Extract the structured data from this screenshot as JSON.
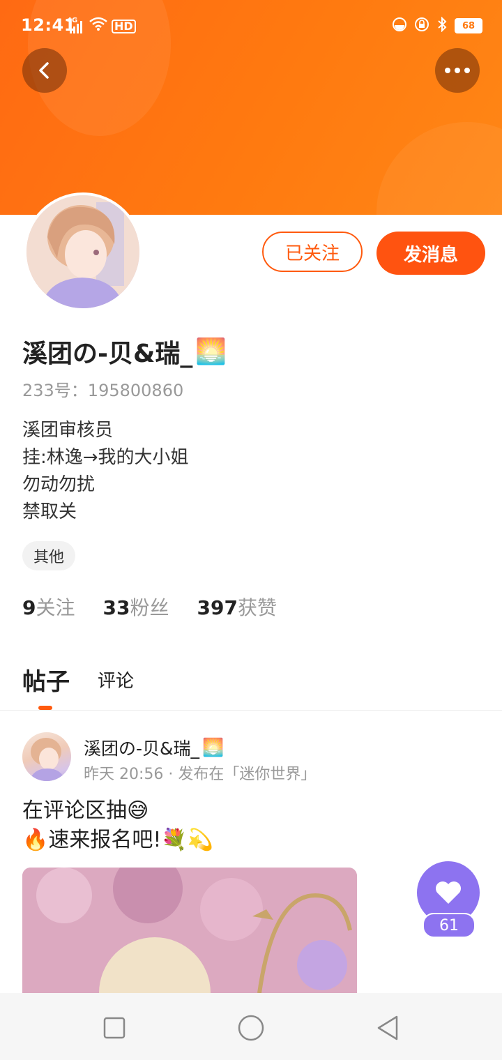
{
  "status_bar": {
    "time": "12:41",
    "network": "4G",
    "hd": "HD",
    "battery": "68",
    "icons": [
      "signal-icon",
      "wifi-icon",
      "hd-icon",
      "mute-icon",
      "lock-icon",
      "bluetooth-icon",
      "battery-icon"
    ]
  },
  "header": {
    "back_icon": "chevron-left-icon",
    "more_icon": "more-dots-icon"
  },
  "profile": {
    "followed_label": "已关注",
    "message_label": "发消息",
    "name": "溪团の-贝&瑞_",
    "name_emoji": "🌅",
    "id_text": "233号：195800860",
    "bio": [
      "溪团审核员",
      "挂:林逸→我的大小姐",
      "勿动勿扰",
      "禁取关"
    ],
    "tag": "其他",
    "stats": [
      {
        "value": "9",
        "label": "关注"
      },
      {
        "value": "33",
        "label": "粉丝"
      },
      {
        "value": "397",
        "label": "获赞"
      }
    ]
  },
  "tabs": {
    "posts": "帖子",
    "comments": "评论",
    "active": "帖子"
  },
  "post": {
    "author": "溪团の-贝&瑞_",
    "author_emoji": "🌅",
    "meta": "昨天 20:56 · 发布在「迷你世界」",
    "line1": "在评论区抽😅",
    "line2": "🔥速来报名吧!💐💫",
    "likes": "61"
  },
  "colors": {
    "accent": "#ff5a0e",
    "banner": "#ff7a10",
    "like": "#8d73f0"
  }
}
